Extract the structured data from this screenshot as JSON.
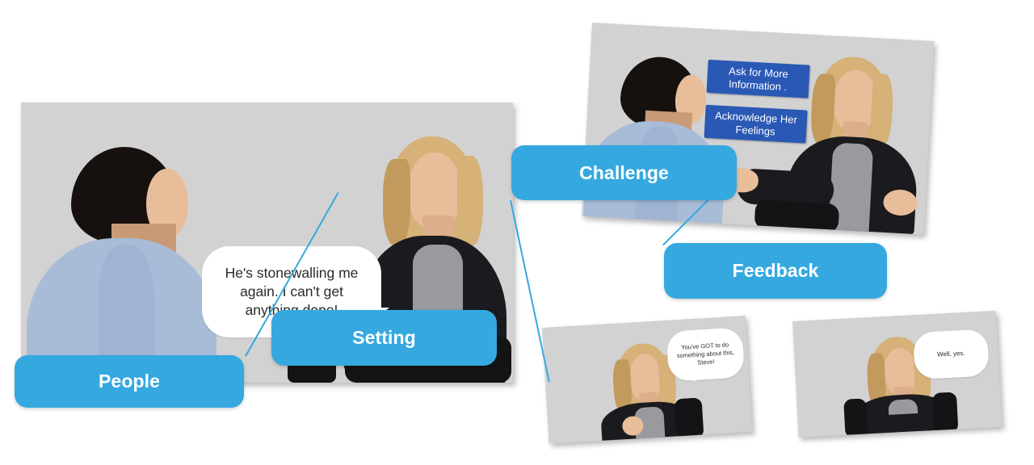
{
  "accent_color": "#35a8e0",
  "chip_color": "#2a58b5",
  "panel_bg_color": "#d2d2d2",
  "labels": [
    {
      "id": "people",
      "text": "People"
    },
    {
      "id": "setting",
      "text": "Setting"
    },
    {
      "id": "challenge",
      "text": "Challenge"
    },
    {
      "id": "feedback",
      "text": "Feedback"
    }
  ],
  "panels": {
    "setting_scene": {
      "name": "setting-scene",
      "speech": "He's stonewalling me again. I can't get anything done!"
    },
    "challenge_scene": {
      "name": "challenge-scene",
      "chips": [
        {
          "id": "ask-more-info",
          "text": "Ask for More Information ."
        },
        {
          "id": "acknowledge-feelings",
          "text": "Acknowledge Her Feelings"
        }
      ]
    },
    "feedback_scene_left": {
      "name": "feedback-scene-left",
      "speech": "You've GOT to do something about this, Steve!"
    },
    "feedback_scene_right": {
      "name": "feedback-scene-right",
      "speech": "Well, yes."
    }
  }
}
